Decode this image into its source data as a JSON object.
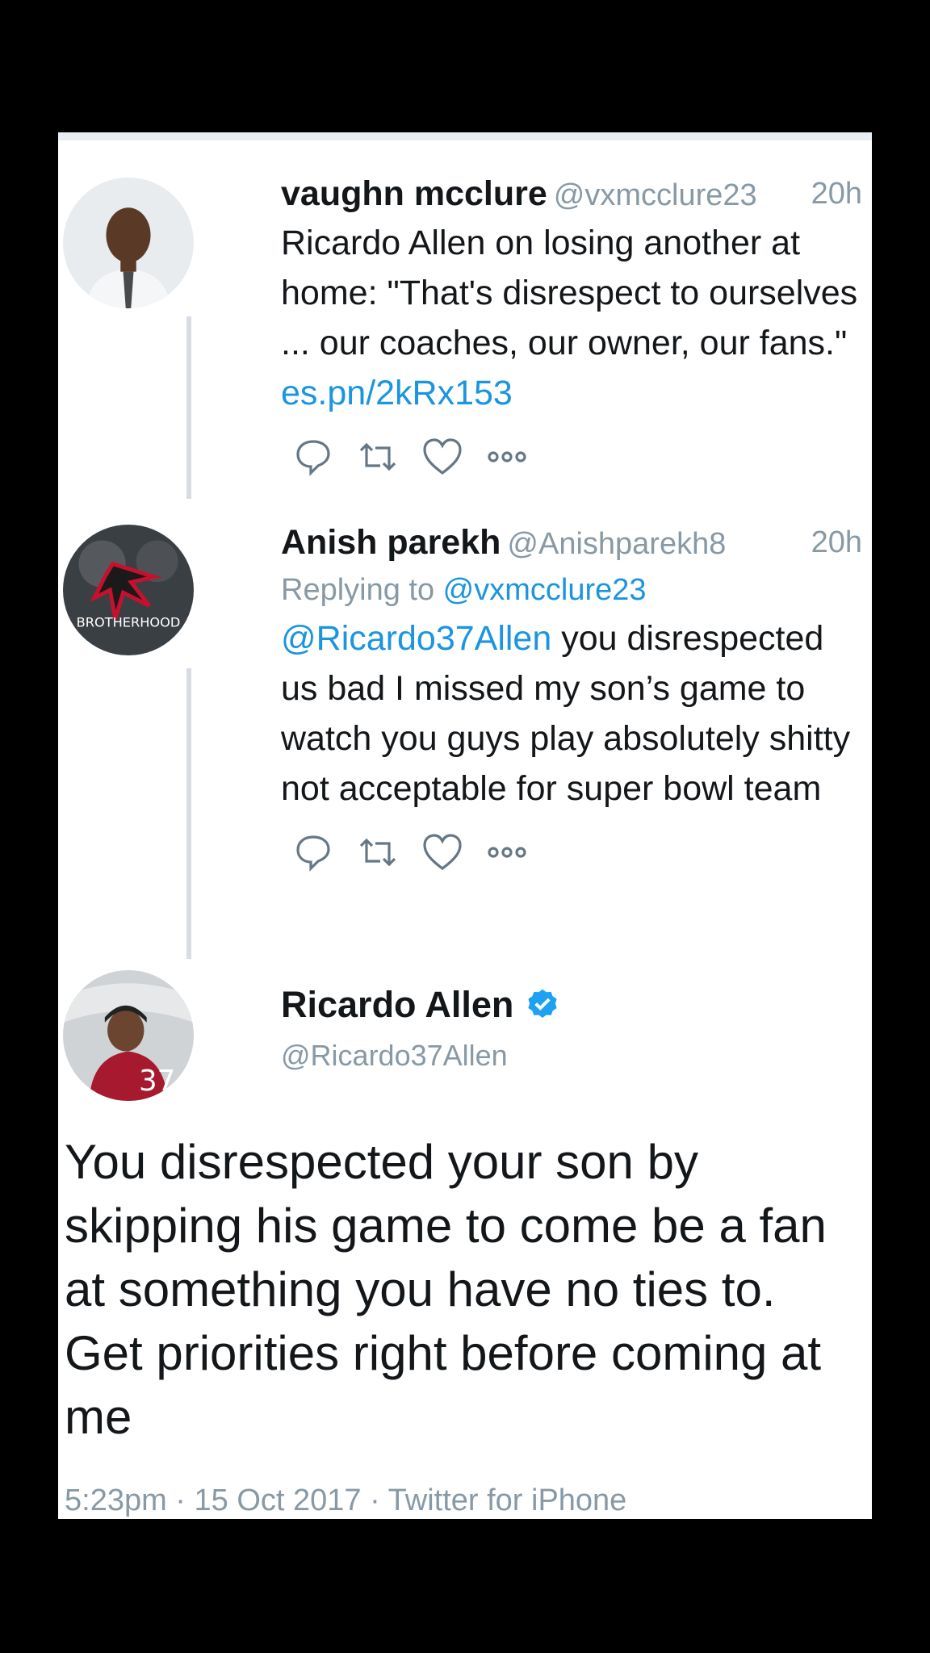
{
  "tweets": [
    {
      "name": "vaughn mcclure",
      "handle": "@vxmcclure23",
      "time": "20h",
      "text_before_link": "Ricardo Allen on losing another at home: \"That's disrespect to ourselves ... our coaches, our owner, our fans.\" ",
      "link": "es.pn/2kRx153",
      "avatar_icon": "man-portrait-avatar"
    },
    {
      "name": "Anish parekh",
      "handle": "@Anishparekh8",
      "time": "20h",
      "replying_label": "Replying to ",
      "replying_to": "@vxmcclure23",
      "mention": "@Ricardo37Allen",
      "text_after_mention": " you disrespected us bad I missed my son’s game to watch you guys play absolutely shitty not acceptable for super bowl team",
      "avatar_icon": "falcons-logo-avatar",
      "avatar_text": "BROTHERHOOD"
    }
  ],
  "main_tweet": {
    "name": "Ricardo Allen",
    "verified_icon": "verified-badge-icon",
    "handle": "@Ricardo37Allen",
    "text": "You disrespected your son by skipping his game to come be a fan at something you have no ties to. Get priorities right before coming at me",
    "meta": "5:23pm · 15 Oct 2017 · Twitter for iPhone",
    "avatar_icon": "football-player-avatar"
  },
  "action_icons": [
    "reply-icon",
    "retweet-icon",
    "like-icon",
    "more-icon"
  ],
  "colors": {
    "link": "#1b95e0",
    "muted": "#8899a6",
    "text": "#14171a",
    "verified": "#1da1f2",
    "background": "#000000"
  }
}
